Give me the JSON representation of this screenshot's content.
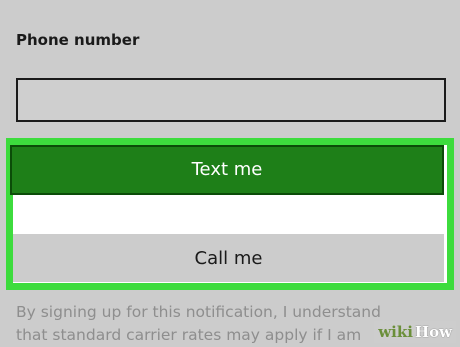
{
  "form": {
    "phone_label": "Phone number",
    "phone_value": "",
    "text_me_label": "Text me",
    "call_me_label": "Call me"
  },
  "disclaimer": {
    "line1": "By signing up for this notification, I understand",
    "line2": "that standard carrier rates may apply if I am"
  },
  "watermark": {
    "part1": "wiki",
    "part2": "How"
  },
  "colors": {
    "highlight": "#3ddc3d",
    "primary_button": "#1e7f18",
    "background": "#cccccc"
  }
}
